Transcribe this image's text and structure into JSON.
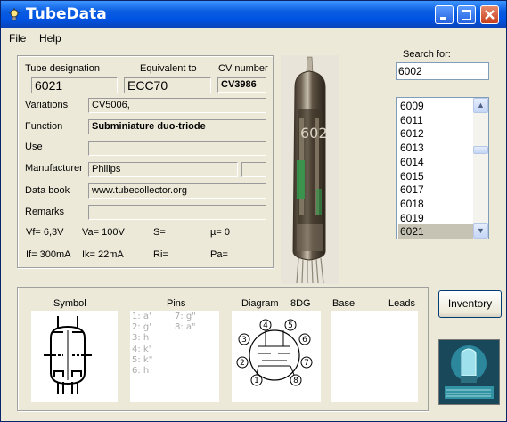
{
  "app": {
    "title": "TubeData",
    "accent": "#0054e3"
  },
  "menu": {
    "file": "File",
    "help": "Help"
  },
  "labels": {
    "tube_designation": "Tube designation",
    "equivalent_to": "Equivalent to",
    "cv_number": "CV number",
    "variations": "Variations",
    "function": "Function",
    "use": "Use",
    "manufacturer": "Manufacturer",
    "data_book": "Data book",
    "remarks": "Remarks"
  },
  "values": {
    "tube_designation": "6021",
    "equivalent_to": "ECC70",
    "cv_number": "CV3986",
    "variations": "CV5006,",
    "function": "Subminiature duo-triode",
    "use": "",
    "manufacturer": "Philips",
    "manufacturer_extra": "",
    "data_book": "www.tubecollector.org",
    "remarks": ""
  },
  "params": {
    "vf": "Vf= 6,3V",
    "va": "Va= 100V",
    "s": "S=",
    "mu": "µ=   0",
    "if": "If= 300mA",
    "ik": "Ik=  22mA",
    "ri": "Ri=",
    "pa": "Pa="
  },
  "search": {
    "label": "Search for:",
    "value": "6002"
  },
  "list": {
    "items": [
      "6009",
      "6011",
      "6012",
      "6013",
      "6014",
      "6015",
      "6017",
      "6018",
      "6019",
      "6021"
    ],
    "selected": "6021"
  },
  "bottom": {
    "symbol": "Symbol",
    "pins": "Pins",
    "diagram": "Diagram",
    "diagram_code": "8DG",
    "base": "Base",
    "leads": "Leads",
    "inventory": "Inventory",
    "pins_col1": [
      "1: a'",
      "2: g'",
      "3: h",
      "4: k'",
      "5: k\"",
      "6: h"
    ],
    "pins_col2": [
      "7: g\"",
      "8: a\""
    ]
  },
  "tube_photo": {
    "print_text": "602"
  },
  "icons": {
    "app": "tube-icon",
    "logo": "tubecollector-logo-icon"
  }
}
